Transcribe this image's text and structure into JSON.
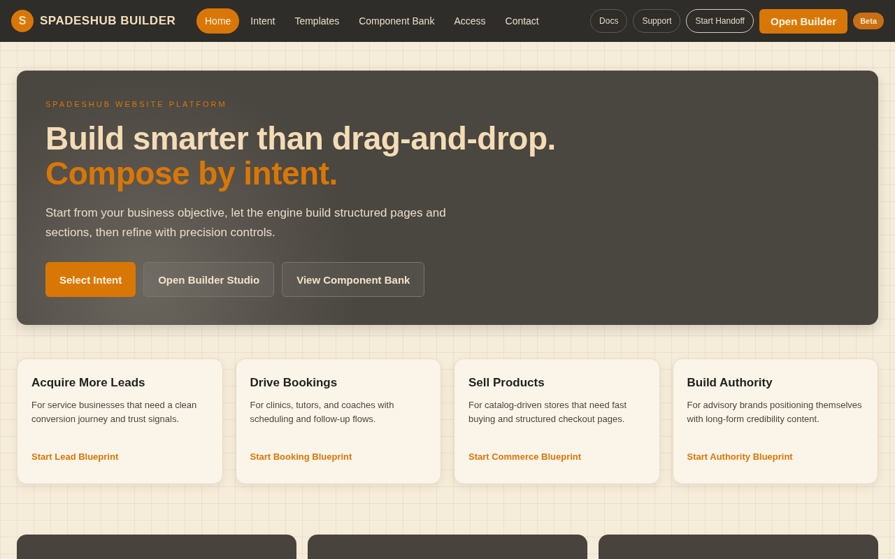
{
  "brand": {
    "mark": "S",
    "name": "SPADESHUB BUILDER"
  },
  "nav": [
    {
      "label": "Home",
      "selected": true
    },
    {
      "label": "Intent",
      "selected": false
    },
    {
      "label": "Templates",
      "selected": false
    },
    {
      "label": "Component Bank",
      "selected": false
    },
    {
      "label": "Access",
      "selected": false
    },
    {
      "label": "Contact",
      "selected": false
    }
  ],
  "actions": [
    {
      "label": "Docs",
      "kind": "ghost"
    },
    {
      "label": "Support",
      "kind": "ghost"
    },
    {
      "label": "Start Handoff",
      "kind": "outline"
    },
    {
      "label": "Open Builder",
      "kind": "primary"
    }
  ],
  "badge": "Beta",
  "hero": {
    "eyebrow": "SPADESHUB WEBSITE PLATFORM",
    "title": "Build smarter than drag-and-drop.",
    "accent": "Compose by intent.",
    "text": "Start from your business objective, let the engine build structured pages and sections, then refine with precision controls.",
    "buttons": [
      {
        "label": "Select Intent",
        "kind": "primary"
      },
      {
        "label": "Open Builder Studio",
        "kind": "ghost"
      },
      {
        "label": "View Component Bank",
        "kind": "ghost"
      }
    ]
  },
  "intents": [
    {
      "title": "Acquire More Leads",
      "text": "For service businesses that need a clean conversion journey and trust signals.",
      "link": "Start Lead Blueprint"
    },
    {
      "title": "Drive Bookings",
      "text": "For clinics, tutors, and coaches with scheduling and follow-up flows.",
      "link": "Start Booking Blueprint"
    },
    {
      "title": "Sell Products",
      "text": "For catalog-driven stores that need fast buying and structured checkout pages.",
      "link": "Start Commerce Blueprint"
    },
    {
      "title": "Build Authority",
      "text": "For advisory brands positioning themselves with long-form credibility content.",
      "link": "Start Authority Blueprint"
    }
  ],
  "panels": [
    {
      "kind": "panel"
    },
    {
      "kind": "panel"
    },
    {
      "kind": "panel"
    }
  ]
}
